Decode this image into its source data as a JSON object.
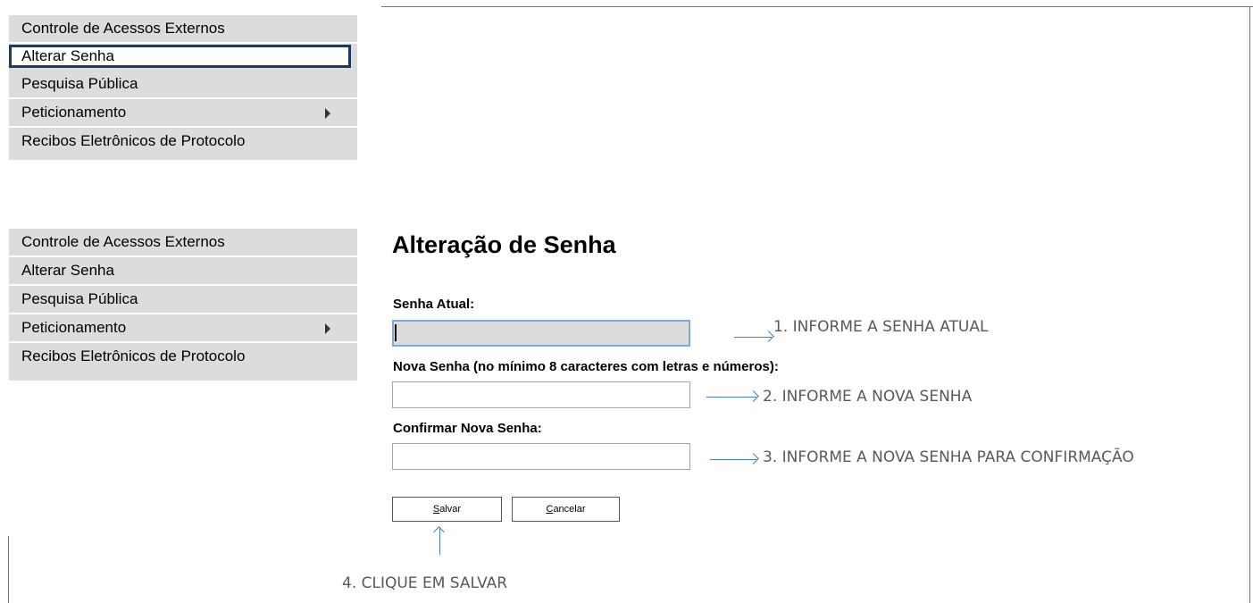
{
  "menu_top": {
    "items": [
      {
        "label": "Controle de Acessos Externos"
      },
      {
        "label": "Alterar Senha"
      },
      {
        "label": "Pesquisa Pública"
      },
      {
        "label": "Peticionamento"
      },
      {
        "label": "Recibos Eletrônicos de Protocolo"
      }
    ]
  },
  "menu_bottom": {
    "items": [
      {
        "label": "Controle de Acessos Externos"
      },
      {
        "label": "Alterar Senha"
      },
      {
        "label": "Pesquisa Pública"
      },
      {
        "label": "Peticionamento"
      },
      {
        "label": "Recibos Eletrônicos de Protocolo"
      }
    ]
  },
  "form": {
    "title": "Alteração de Senha",
    "current_password_label": "Senha Atual:",
    "new_password_label": "Nova Senha (no mínimo 8 caracteres com letras e números):",
    "confirm_password_label": "Confirmar Nova Senha:",
    "save_label": "Salvar",
    "cancel_label": "Cancelar",
    "save_accesskey": "S",
    "save_rest": "alvar",
    "cancel_accesskey": "C",
    "cancel_rest": "ancelar"
  },
  "annotations": {
    "step1": "1. INFORME A SENHA ATUAL",
    "step2": "2. INFORME A NOVA SENHA",
    "step3": "3. INFORME A NOVA SENHA PARA CONFIRMAÇÃO",
    "step4": "4. CLIQUE EM SALVAR"
  },
  "colors": {
    "menu_bg": "#dcdcdc",
    "annotation_arrow": "#4a7ebb",
    "annotation_text": "#595959"
  }
}
